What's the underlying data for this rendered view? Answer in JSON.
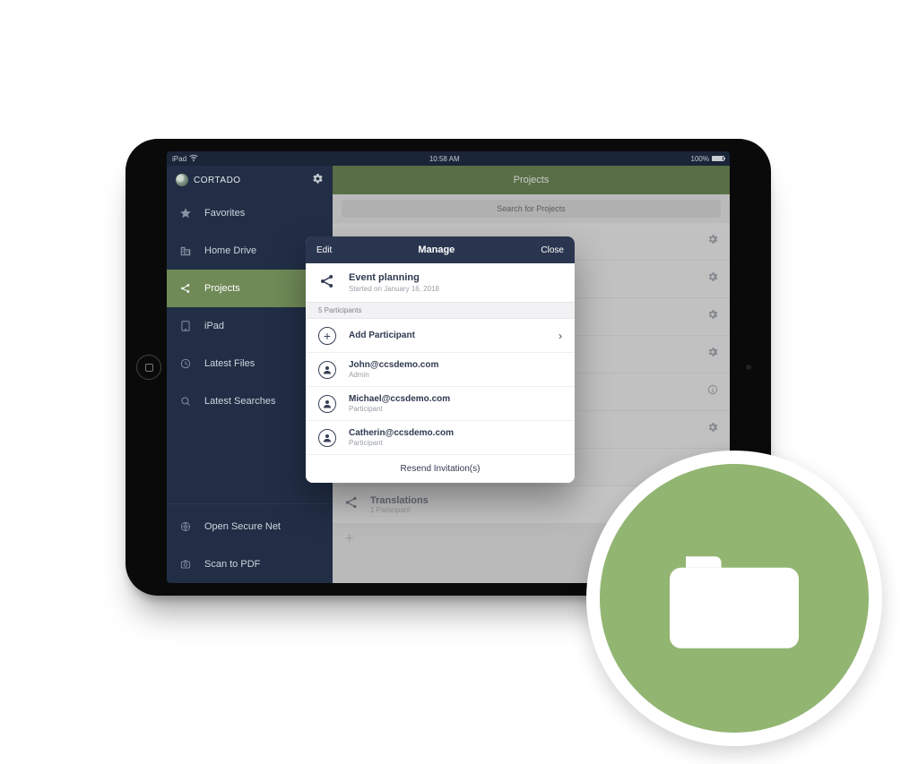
{
  "statusbar": {
    "device": "iPad",
    "time": "10:58 AM",
    "battery": "100%"
  },
  "brand": {
    "name": "CORTADO"
  },
  "sidebar": {
    "items": [
      {
        "label": "Favorites"
      },
      {
        "label": "Home Drive"
      },
      {
        "label": "Projects"
      },
      {
        "label": "iPad"
      },
      {
        "label": "Latest Files"
      },
      {
        "label": "Latest Searches"
      }
    ],
    "bottom": [
      {
        "label": "Open Secure Net"
      },
      {
        "label": "Scan to PDF"
      }
    ]
  },
  "main": {
    "header": "Projects",
    "search_placeholder": "Search for Projects",
    "bg_project": {
      "title": "Translations",
      "sub": "1 Participant"
    }
  },
  "modal": {
    "edit": "Edit",
    "title": "Manage",
    "close": "Close",
    "project": {
      "title": "Event planning",
      "sub": "Started on January 16, 2018"
    },
    "participants_header": "5 Participants",
    "add_label": "Add Participant",
    "people": [
      {
        "email": "John@ccsdemo.com",
        "role": "Admin"
      },
      {
        "email": "Michael@ccsdemo.com",
        "role": "Participant"
      },
      {
        "email": "Catherin@ccsdemo.com",
        "role": "Participant"
      }
    ],
    "footer": "Resend Invitation(s)"
  }
}
